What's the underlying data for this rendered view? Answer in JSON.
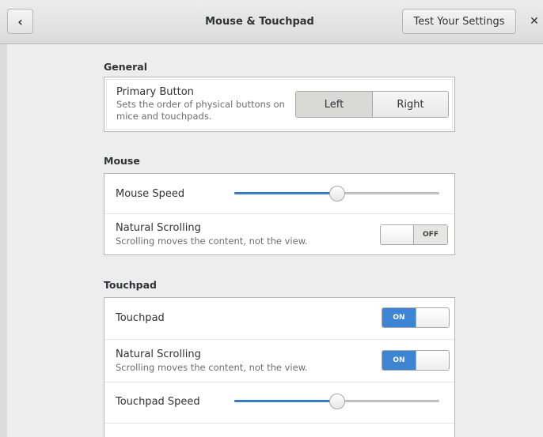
{
  "header": {
    "title": "Mouse & Touchpad",
    "test_button": "Test Your Settings",
    "back_icon": "chevron-left-icon",
    "close_icon": "close-icon"
  },
  "general": {
    "section_title": "General",
    "primary_button": {
      "label": "Primary Button",
      "description_line1": "Sets the order of physical buttons on",
      "description_line2": "mice and touchpads.",
      "options": [
        "Left",
        "Right"
      ],
      "selected": "Left"
    }
  },
  "mouse": {
    "section_title": "Mouse",
    "speed": {
      "label": "Mouse Speed",
      "value_fraction": 0.5
    },
    "natural_scrolling": {
      "label": "Natural Scrolling",
      "description": "Scrolling moves the content, not the view.",
      "state": "OFF"
    }
  },
  "touchpad": {
    "section_title": "Touchpad",
    "touchpad_toggle": {
      "label": "Touchpad",
      "state": "ON"
    },
    "natural_scrolling": {
      "label": "Natural Scrolling",
      "description": "Scrolling moves the content, not the view.",
      "state": "ON"
    },
    "speed": {
      "label": "Touchpad Speed",
      "value_fraction": 0.5
    }
  },
  "colors": {
    "accent": "#3d84d3",
    "background": "#ededed"
  }
}
